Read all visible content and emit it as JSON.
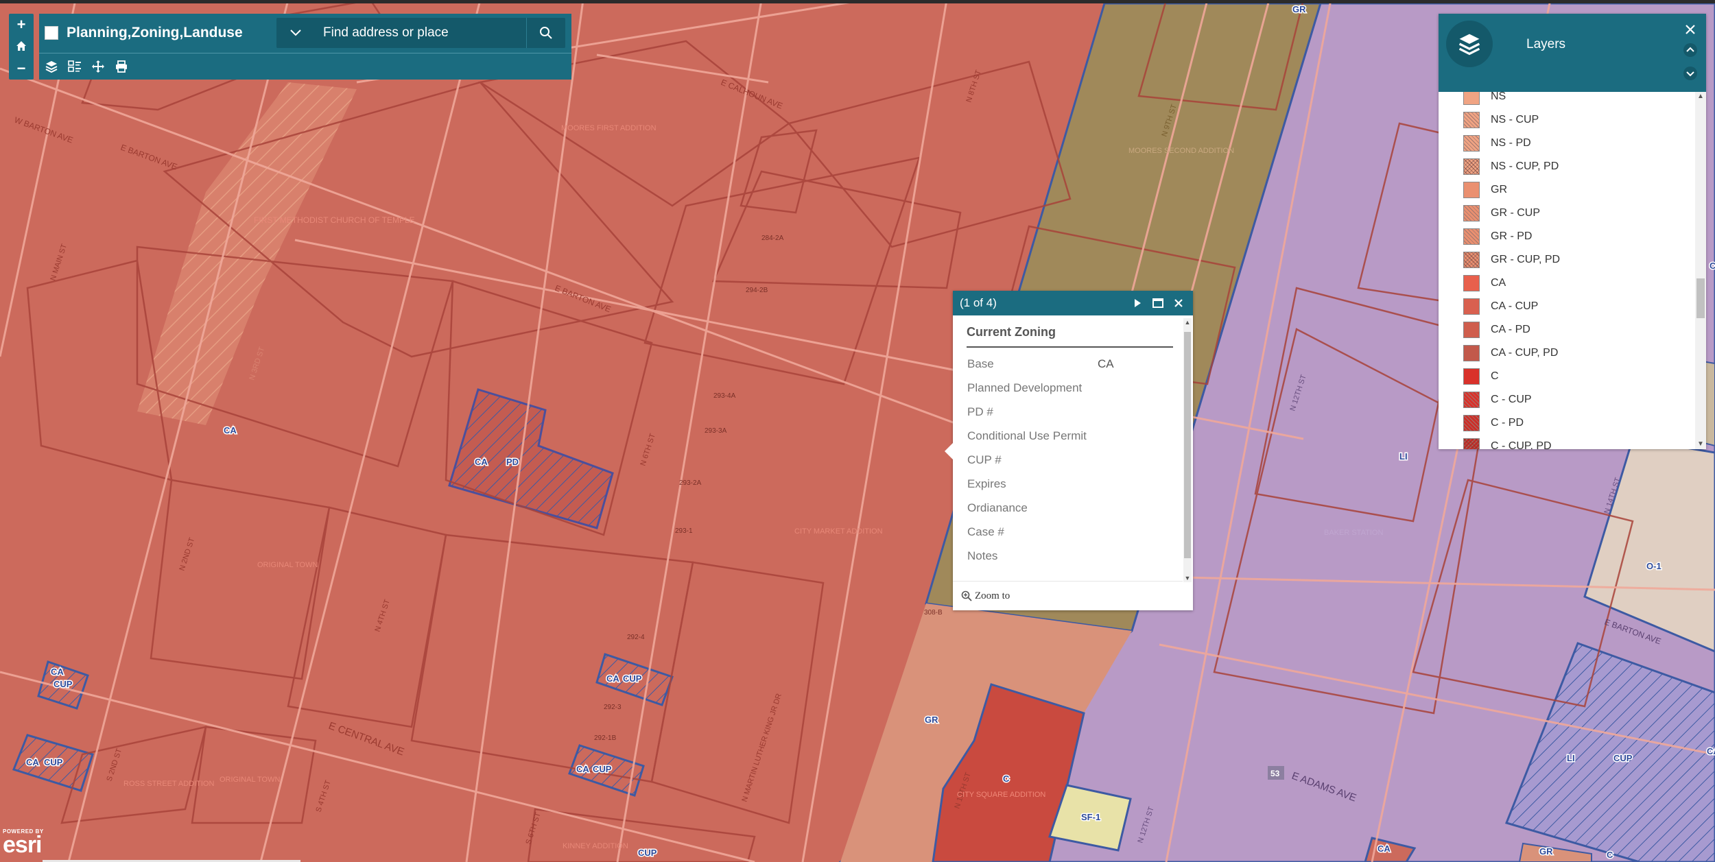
{
  "app": {
    "title": "Planning,Zoning,Landuse",
    "search_placeholder": "Find address or place",
    "zoom_in": "+",
    "zoom_out": "−",
    "icons": {
      "zoom_in": "plus-icon",
      "home": "home-icon",
      "zoom_out": "minus-icon",
      "search_dropdown": "chevron-down-icon",
      "search": "search-icon",
      "layers_tool": "layers-icon",
      "legend_tool": "legend-icon",
      "measure_tool": "measure-icon",
      "print_tool": "print-icon"
    },
    "colors": {
      "header": "#1b6c80",
      "search_bg": "#14596a"
    }
  },
  "popup": {
    "count_label": "(1 of 4)",
    "title": "Current Zoning",
    "fields": [
      {
        "label": "Base",
        "value": "CA"
      },
      {
        "label": "Planned Development",
        "value": ""
      },
      {
        "label": "PD #",
        "value": ""
      },
      {
        "label": "Conditional Use Permit",
        "value": ""
      },
      {
        "label": "CUP #",
        "value": ""
      },
      {
        "label": "Expires",
        "value": ""
      },
      {
        "label": "Ordianance",
        "value": ""
      },
      {
        "label": "Case #",
        "value": ""
      },
      {
        "label": "Notes",
        "value": ""
      }
    ],
    "zoom_to_label": "Zoom to",
    "icons": {
      "next": "play-right-icon",
      "maximize": "maximize-icon",
      "close": "close-icon",
      "zoom_to": "zoom-in-magnifier-icon"
    }
  },
  "layers_panel": {
    "title": "Layers",
    "icons": {
      "header": "layers-stack-icon",
      "close": "close-icon",
      "collapse": "chevron-up-icon",
      "expand": "chevron-down-icon"
    },
    "items": [
      {
        "label": "NS",
        "color": "#f0a483",
        "pattern": "solid"
      },
      {
        "label": "NS - CUP",
        "color": "#f0a483",
        "pattern": "diag"
      },
      {
        "label": "NS - PD",
        "color": "#f0a483",
        "pattern": "diag"
      },
      {
        "label": "NS - CUP, PD",
        "color": "#f0a483",
        "pattern": "cross"
      },
      {
        "label": "GR",
        "color": "#ea9070",
        "pattern": "solid"
      },
      {
        "label": "GR - CUP",
        "color": "#ea9070",
        "pattern": "diag"
      },
      {
        "label": "GR - PD",
        "color": "#ea9070",
        "pattern": "diag"
      },
      {
        "label": "GR - CUP, PD",
        "color": "#ea9070",
        "pattern": "cross"
      },
      {
        "label": "CA",
        "color": "#e8604c",
        "pattern": "solid"
      },
      {
        "label": "CA - CUP",
        "color": "#d9604f",
        "pattern": "solid"
      },
      {
        "label": "CA - PD",
        "color": "#cf5e4d",
        "pattern": "solid"
      },
      {
        "label": "CA - CUP, PD",
        "color": "#c2594b",
        "pattern": "solid"
      },
      {
        "label": "C",
        "color": "#d9312a",
        "pattern": "solid"
      },
      {
        "label": "C - CUP",
        "color": "#d9312a",
        "pattern": "diag"
      },
      {
        "label": "C - PD",
        "color": "#cc2e28",
        "pattern": "diag"
      },
      {
        "label": "C - CUP, PD",
        "color": "#c42c27",
        "pattern": "cross"
      }
    ]
  },
  "map": {
    "colors": {
      "ca_zone": "#cc6a5c",
      "gr_zone": "#a0895a",
      "li_zone": "#b89ac6",
      "c_zone": "#c94a3f",
      "gr_light_zone": "#d9927a",
      "sf_zone": "#e8e2a8",
      "o_zone": "#e0cfc2",
      "zone_outline": "#3d5aa3"
    },
    "street_labels": [
      {
        "text": "W BARTON AVE"
      },
      {
        "text": "E BARTON AVE"
      },
      {
        "text": "E CALHOUN AVE"
      },
      {
        "text": "E BARTON AVE"
      },
      {
        "text": "N MAIN ST"
      },
      {
        "text": "N 2ND ST"
      },
      {
        "text": "N 3RD ST"
      },
      {
        "text": "N 4TH ST"
      },
      {
        "text": "N 6TH ST"
      },
      {
        "text": "N 8TH ST"
      },
      {
        "text": "N 9TH ST"
      },
      {
        "text": "N 10TH ST"
      },
      {
        "text": "N 12TH ST"
      },
      {
        "text": "N 12TH ST"
      },
      {
        "text": "N 14TH ST"
      },
      {
        "text": "E CENTRAL AVE"
      },
      {
        "text": "S 2ND ST"
      },
      {
        "text": "S 4TH ST"
      },
      {
        "text": "S 6TH ST"
      },
      {
        "text": "N MARTIN LUTHER KING JR DR"
      },
      {
        "text": "E ADAMS AVE"
      },
      {
        "text": "E BARTON AVE"
      },
      {
        "text": "53"
      }
    ],
    "subdivision_labels": [
      {
        "text": "MOORES FIRST ADDITION"
      },
      {
        "text": "FIRST METHODIST CHURCH OF TEMPLE"
      },
      {
        "text": "MOORES SECOND ADDITION"
      },
      {
        "text": "ORIGINAL TOWN"
      },
      {
        "text": "ORIGINAL TOWN"
      },
      {
        "text": "CITY MARKET ADDITION"
      },
      {
        "text": "BAKER STATION"
      },
      {
        "text": "CITY SQUARE ADDITION"
      },
      {
        "text": "ROSS STREET ADDITION"
      },
      {
        "text": "KINNEY ADDITION"
      }
    ],
    "block_labels": [
      {
        "text": "284-2A"
      },
      {
        "text": "294-2B"
      },
      {
        "text": "293-4A"
      },
      {
        "text": "293-3A"
      },
      {
        "text": "293-2A"
      },
      {
        "text": "293-1"
      },
      {
        "text": "292-4"
      },
      {
        "text": "292-3"
      },
      {
        "text": "292-1B"
      },
      {
        "text": "308-B"
      }
    ],
    "zone_labels": [
      {
        "text": "GR"
      },
      {
        "text": "CA"
      },
      {
        "text": "CA"
      },
      {
        "text": "PD"
      },
      {
        "text": "CA"
      },
      {
        "text": "CUP"
      },
      {
        "text": "CA"
      },
      {
        "text": "CUP"
      },
      {
        "text": "CA"
      },
      {
        "text": "CUP"
      },
      {
        "text": "CA"
      },
      {
        "text": "CUP"
      },
      {
        "text": "CUP"
      },
      {
        "text": "GR"
      },
      {
        "text": "C"
      },
      {
        "text": "SF-1"
      },
      {
        "text": "LI"
      },
      {
        "text": "LI"
      },
      {
        "text": "CUP"
      },
      {
        "text": "O-1"
      },
      {
        "text": "CA"
      },
      {
        "text": "GR"
      },
      {
        "text": "C"
      },
      {
        "text": "C"
      },
      {
        "text": "CA"
      }
    ]
  },
  "esri": {
    "powered_by": "POWERED BY",
    "word": "esri"
  }
}
